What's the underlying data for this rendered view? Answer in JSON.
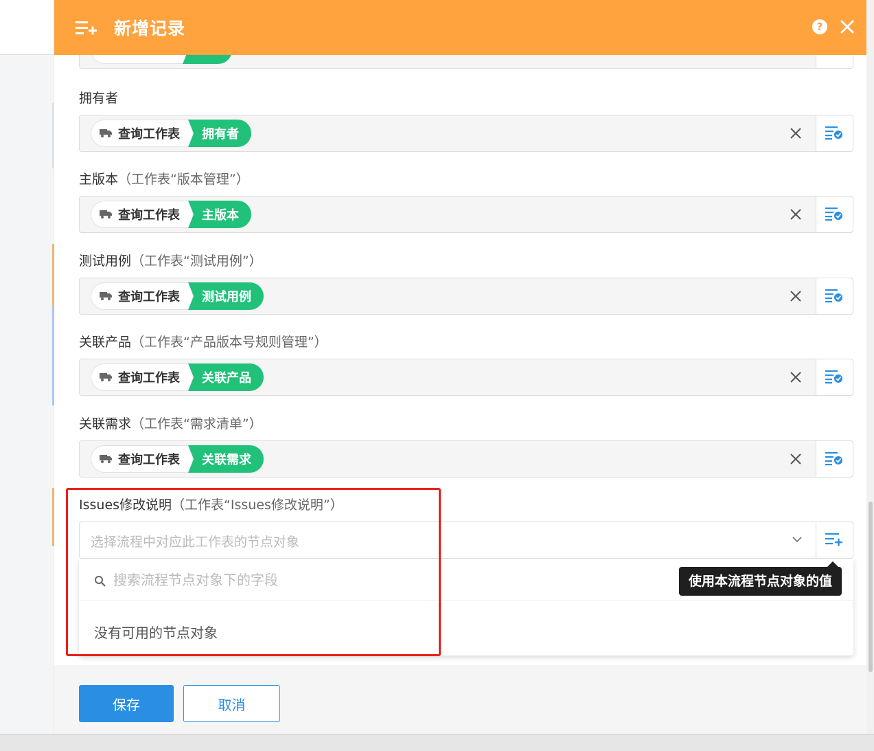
{
  "dialog": {
    "title": "新增记录",
    "help_label": "?",
    "colors": {
      "header": "#fea33e",
      "tag_green": "#21c17a",
      "primary": "#2a8fe3",
      "highlight_box": "#e8211d"
    }
  },
  "fields": [
    {
      "label": "拥有者",
      "paren": "",
      "source": "查询工作表",
      "target": "拥有者"
    },
    {
      "label": "主版本",
      "paren": "（工作表“版本管理”）",
      "source": "查询工作表",
      "target": "主版本"
    },
    {
      "label": "测试用例",
      "paren": "（工作表“测试用例”）",
      "source": "查询工作表",
      "target": "测试用例"
    },
    {
      "label": "关联产品",
      "paren": "（工作表“产品版本号规则管理”）",
      "source": "查询工作表",
      "target": "关联产品"
    },
    {
      "label": "关联需求",
      "paren": "（工作表“需求清单”）",
      "source": "查询工作表",
      "target": "关联需求"
    }
  ],
  "issues_field": {
    "label": "Issues修改说明",
    "paren": "（工作表“Issues修改说明”）",
    "select_placeholder": "选择流程中对应此工作表的节点对象",
    "search_placeholder": "搜索流程节点对象下的字段",
    "empty_text": "没有可用的节点对象",
    "tooltip": "使用本流程节点对象的值"
  },
  "footer": {
    "save_label": "保存",
    "cancel_label": "取消"
  },
  "icons": [
    "add-record-icon",
    "help-icon",
    "close-icon",
    "truck-icon",
    "clear-icon",
    "field-value-icon",
    "chevron-down-icon",
    "search-icon",
    "add-field-icon"
  ]
}
